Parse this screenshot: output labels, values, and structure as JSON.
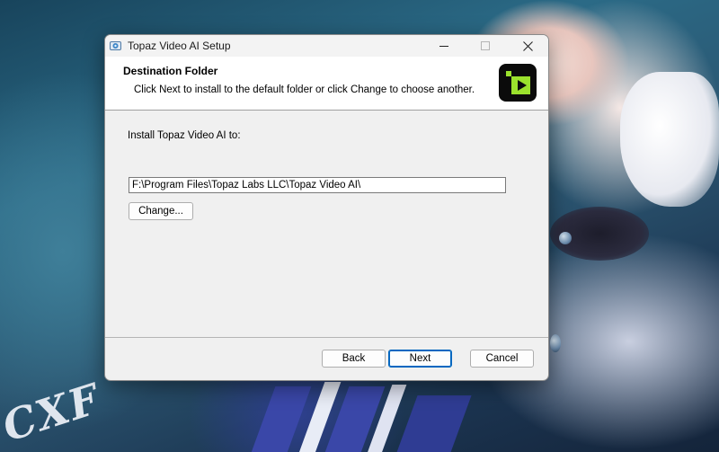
{
  "window": {
    "title": "Topaz Video AI Setup",
    "controls": {
      "minimize": "minimize",
      "maximize": "maximize",
      "close": "close"
    }
  },
  "header": {
    "title": "Destination Folder",
    "description": "Click Next to install to the default folder or click Change to choose another."
  },
  "content": {
    "install_label": "Install Topaz Video AI to:",
    "install_path": "F:\\Program Files\\Topaz Labs LLC\\Topaz Video AI\\",
    "change_button": "Change..."
  },
  "footer": {
    "back_button": "Back",
    "next_button": "Next",
    "cancel_button": "Cancel"
  },
  "colors": {
    "window_bg": "#f0f0f0",
    "header_bg": "#ffffff",
    "logo_bg": "#0b0b0b",
    "logo_accent": "#9be22d",
    "default_button_border": "#0067c0"
  },
  "icons": [
    "installer-app-icon",
    "minimize-icon",
    "maximize-icon",
    "close-icon",
    "topaz-video-ai-logo"
  ]
}
